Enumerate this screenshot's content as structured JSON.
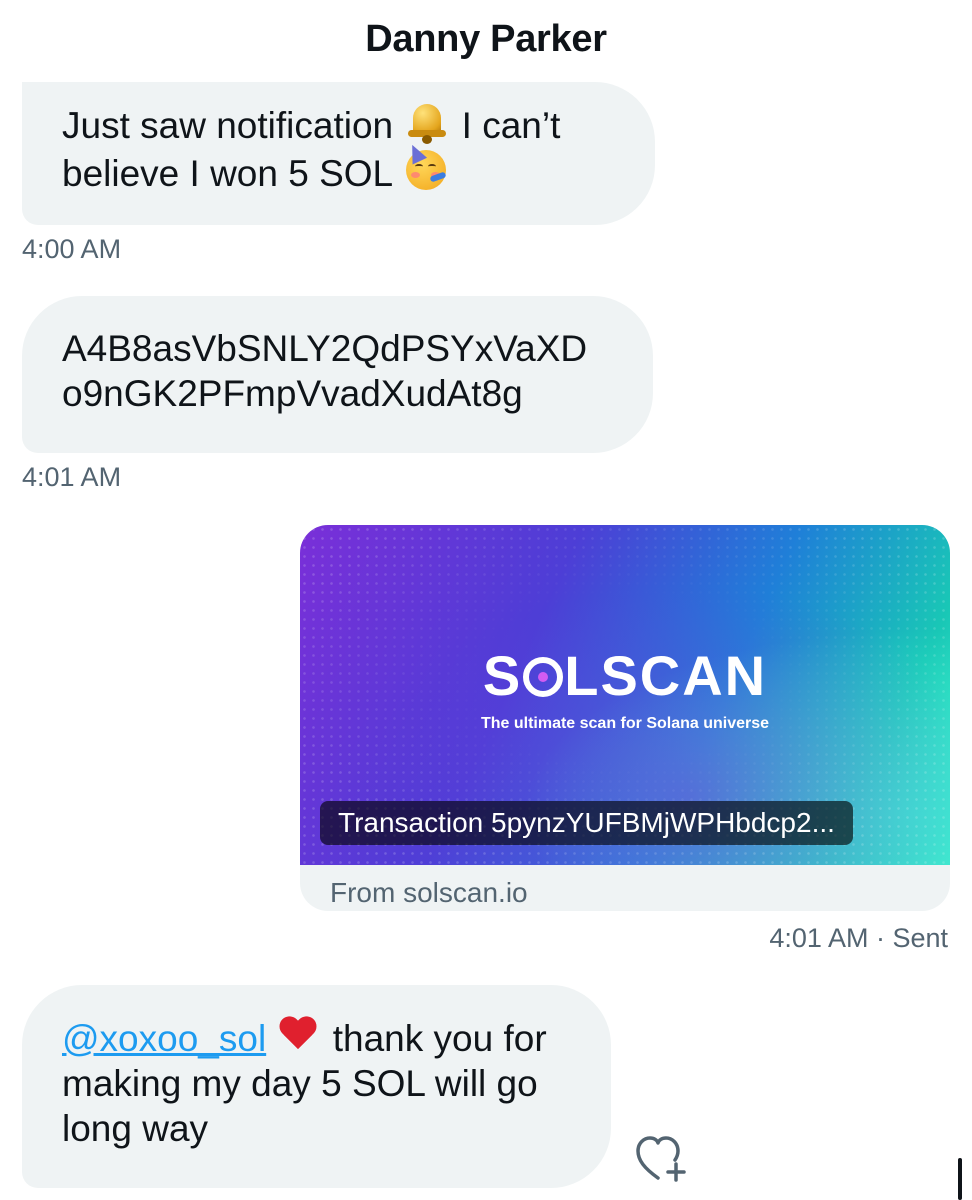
{
  "header": {
    "title": "Danny Parker"
  },
  "messages": [
    {
      "direction": "incoming",
      "text_a": "Just saw notification",
      "emoji_a": "bell-emoji",
      "text_b": " I can’t believe I won 5 SOL",
      "emoji_b": "partying-face-emoji",
      "time": "4:00 AM"
    },
    {
      "direction": "incoming",
      "text": "A4B8asVbSNLY2QdPSYxVaXD o9nGK2PFmpVvadXudAt8g",
      "time": "4:01 AM"
    },
    {
      "direction": "outgoing",
      "card": {
        "logo_text_a": "S",
        "logo_text_b": "LSCAN",
        "tagline": "The ultimate scan for Solana universe",
        "title": "Transaction 5pynzYUFBMjWPHbdcp2...",
        "source": "From solscan.io",
        "colors": {
          "gradient_start": "#7a2fd8",
          "gradient_end": "#3ef0c8"
        }
      },
      "time": "4:01 AM · Sent"
    },
    {
      "direction": "incoming",
      "mention": "@xoxoo_sol",
      "emoji": "red-heart-emoji",
      "text": " thank you for making my day 5 SOL will go long way"
    }
  ],
  "actions": {
    "react_icon": "heart-plus-icon"
  },
  "colors": {
    "bubble": "#eff3f4",
    "link": "#1d9bf0",
    "muted": "#536471"
  }
}
